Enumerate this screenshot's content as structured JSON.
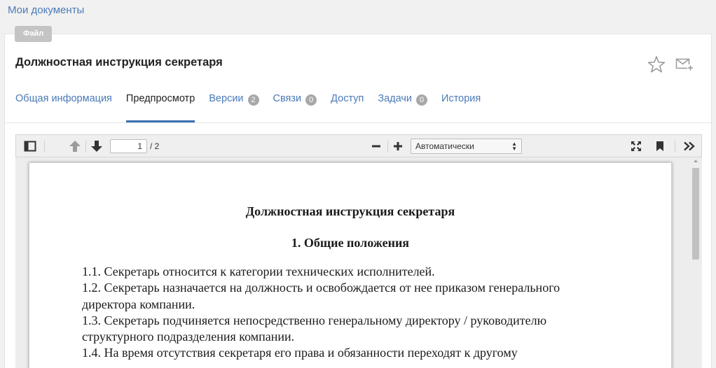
{
  "breadcrumb": {
    "label": "Мои документы"
  },
  "file_badge": {
    "label": "Файл"
  },
  "document": {
    "title": "Должностная инструкция секретаря"
  },
  "actions": {
    "favorite_icon": "star-outline-icon",
    "send_icon": "mail-plus-icon"
  },
  "tabs": [
    {
      "label": "Общая информация"
    },
    {
      "label": "Предпросмотр",
      "active": true
    },
    {
      "label": "Версии",
      "count": "2"
    },
    {
      "label": "Связи",
      "count": "0"
    },
    {
      "label": "Доступ"
    },
    {
      "label": "Задачи",
      "count": "0"
    },
    {
      "label": "История"
    }
  ],
  "viewer": {
    "toolbar": {
      "sidebar_icon": "sidebar-toggle-icon",
      "prev_icon": "arrow-up-icon",
      "next_icon": "arrow-down-icon",
      "page_current": "1",
      "page_total": "/ 2",
      "zoom_out_icon": "minus-icon",
      "zoom_in_icon": "plus-icon",
      "zoom_value": "Автоматически",
      "fullscreen_icon": "fullscreen-icon",
      "bookmark_icon": "bookmark-icon",
      "more_icon": "double-chevron-right-icon"
    },
    "page": {
      "heading": "Должностная инструкция секретаря",
      "section": "1. Общие положения",
      "lines": [
        "1.1. Секретарь относится к категории технических исполнителей.",
        "1.2. Секретарь назначается на должность и освобождается от нее приказом генерального",
        "директора компании.",
        "1.3. Секретарь подчиняется непосредственно генеральному директору / руководителю",
        "структурного подразделения компании.",
        "1.4. На время отсутствия секретаря его права и обязанности переходят к другому"
      ]
    }
  },
  "colors": {
    "accent": "#3b6fb0",
    "link": "#4a7ab8",
    "badge": "#c4c4c4",
    "count_badge": "#a8a8a8"
  }
}
